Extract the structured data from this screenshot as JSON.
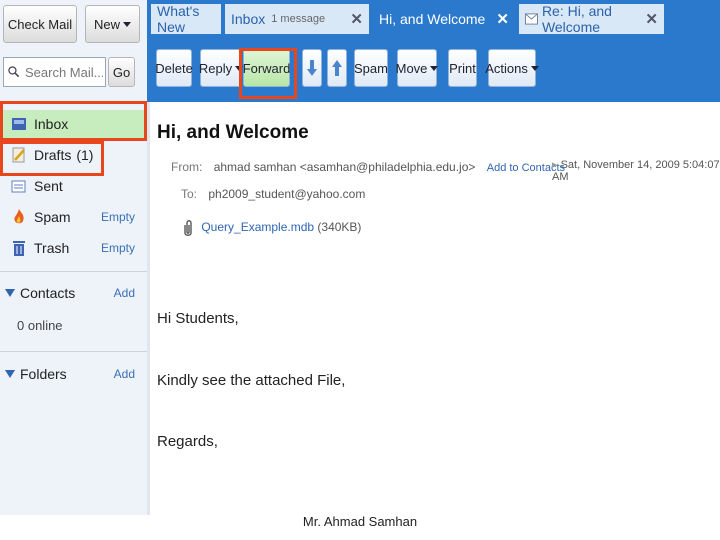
{
  "left": {
    "check_mail_label": "Check Mail",
    "new_label": "New",
    "search_placeholder": "Search Mail...",
    "go_label": "Go",
    "folders": [
      {
        "label": "Inbox",
        "icon": "inbox-icon"
      },
      {
        "label": "Drafts",
        "count": "(1)",
        "icon": "drafts-icon"
      },
      {
        "label": "Sent",
        "icon": "sent-icon"
      },
      {
        "label": "Spam",
        "action": "Empty",
        "icon": "spam-icon"
      },
      {
        "label": "Trash",
        "action": "Empty",
        "icon": "trash-icon"
      }
    ],
    "contacts": {
      "label": "Contacts",
      "action": "Add",
      "status": "0 online"
    },
    "folders_section": {
      "label": "Folders",
      "action": "Add"
    }
  },
  "tabs": [
    {
      "label": "What's New"
    },
    {
      "label": "Inbox",
      "sub": "1 message"
    },
    {
      "label": "Hi, and Welcome"
    },
    {
      "label": "Re: Hi, and Welcome"
    }
  ],
  "toolbar": {
    "delete": "Delete",
    "reply": "Reply",
    "forward": "Forward",
    "spam": "Spam",
    "move": "Move",
    "print": "Print",
    "actions": "Actions"
  },
  "message": {
    "subject": "Hi, and Welcome",
    "from_label": "From:",
    "from_name": "ahmad samhan",
    "from_email": "<asamhan@philadelphia.edu.jo>",
    "add_contact": "Add to Contacts",
    "date": "Sat, November 14, 2009 5:04:07 AM",
    "to_label": "To:",
    "to": "ph2009_student@yahoo.com",
    "attachment_name": "Query_Example.mdb",
    "attachment_size": "(340KB)",
    "body": [
      "Hi Students,",
      "Kindly see the attached File,",
      "Regards,"
    ]
  },
  "footer": "Mr. Ahmad Samhan",
  "colors": {
    "tab_blue": "#2a79cc",
    "highlight": "#e8471e",
    "link": "#2f66b3"
  }
}
